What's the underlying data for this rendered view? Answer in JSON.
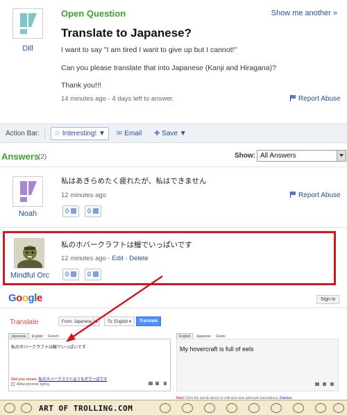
{
  "question": {
    "status": "Open Question",
    "show_another": "Show me another »",
    "title": "Translate to Japanese?",
    "asker": "Dill",
    "body_lines": [
      "I want to say \"I am tired I want to give up but I cannot!\"",
      "Can you please translate that into Japanese (Kanji and Hiragana)?",
      "Thank you!!!"
    ],
    "meta": "14 minutes ago - 4 days left to answer.",
    "report": "Report Abuse"
  },
  "action_bar": {
    "label": "Action Bar:",
    "interesting": "Interesting! ▼",
    "email": "Email",
    "save": "Save ▼"
  },
  "answers_header": {
    "title": "Answers",
    "count": "(2)",
    "show_label": "Show:",
    "show_value": "All Answers"
  },
  "answers": [
    {
      "user": "Noah",
      "text": "私はあきらめたく疲れたが、私はできません",
      "meta": "12 minutes ago",
      "report": "Report Abuse",
      "up": "0",
      "down": "0"
    },
    {
      "user": "Mindful Orc",
      "text": "私のホバークラフトは鰻でいっぱいです",
      "meta_time": "12 minutes ago - ",
      "edit": "Edit",
      "sep": " - ",
      "delete": "Delete",
      "up": "0",
      "down": "0"
    }
  ],
  "translate": {
    "logo_letters": [
      "G",
      "o",
      "o",
      "g",
      "l",
      "e"
    ],
    "logo_colors": [
      "#3369e8",
      "#d50f25",
      "#eeb211",
      "#3369e8",
      "#009925",
      "#d50f25"
    ],
    "sign_in": "Sign in",
    "title": "Translate",
    "from": "From: Japanese ▾",
    "to": "To: English ▾",
    "button": "Translate",
    "in_tabs": [
      "Japanese",
      "English",
      "French"
    ],
    "out_tabs": [
      "English",
      "Japanese",
      "Greek"
    ],
    "input_text": "私のホバークラフトは鰻でいっぱいです",
    "output_text": "My hovercraft is full of eels",
    "did_you_mean": "Did you mean:",
    "suggestion": "私のホバークラフトはうなぎでーぱです",
    "allow_phonetic": "Allow phonetic typing",
    "hint_new": "New!",
    "hint_text": " Click the words above to edit and view alternate translations. ",
    "hint_dismiss": "Dismiss"
  },
  "footer": {
    "brand": "ART OF TROLLING.COM"
  },
  "colors": {
    "green_heading": "#3aa52b",
    "link_blue": "#1f4e9e",
    "highlight_red": "#d3171c"
  }
}
